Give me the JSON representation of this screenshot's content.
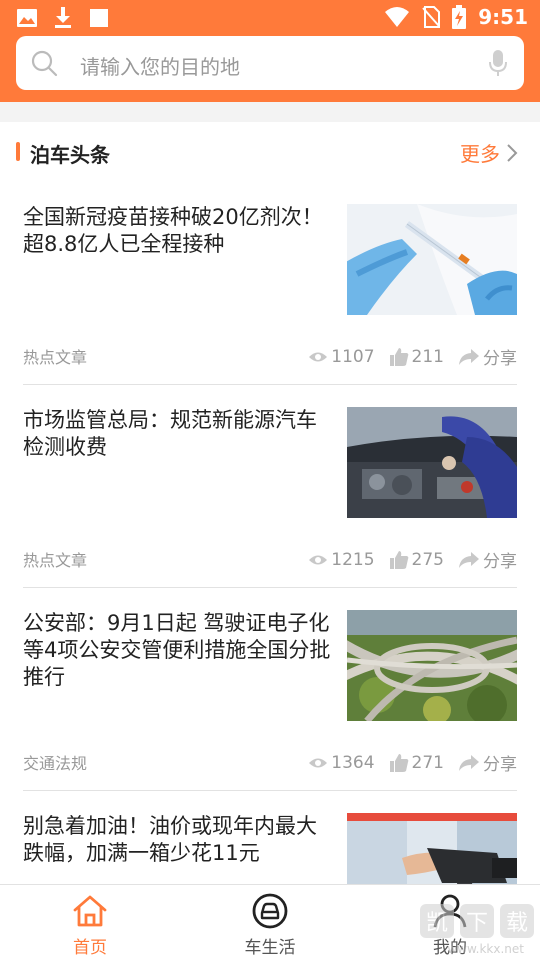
{
  "status_bar": {
    "time": "9:51",
    "left_icons": [
      "image-icon",
      "download-icon",
      "square-icon"
    ],
    "right_icons": [
      "wifi-icon",
      "no-sim-icon",
      "battery-charging-icon"
    ]
  },
  "search": {
    "placeholder": "请输入您的目的地",
    "icon": "search-icon",
    "voice_icon": "microphone-icon"
  },
  "section": {
    "title": "泊车头条",
    "more_label": "更多"
  },
  "articles": [
    {
      "title": "全国新冠疫苗接种破20亿剂次！超8.8亿人已全程接种",
      "category": "热点文章",
      "views": "1107",
      "likes": "211",
      "share": "分享",
      "image": "vaccine-syringe-gloved-hands"
    },
    {
      "title": "市场监管总局：规范新能源汽车检测收费",
      "category": "热点文章",
      "views": "1215",
      "likes": "275",
      "share": "分享",
      "image": "car-engine-inspection"
    },
    {
      "title": "公安部：9月1日起 驾驶证电子化等4项公安交管便利措施全国分批推行",
      "category": "交通法规",
      "views": "1364",
      "likes": "271",
      "share": "分享",
      "image": "highway-interchange-aerial"
    },
    {
      "title": "别急着加油！油价或现年内最大跌幅，加满一箱少花11元",
      "category": "",
      "views": "",
      "likes": "",
      "share": "",
      "image": "fuel-pump-nozzle"
    }
  ],
  "tabbar": {
    "tabs": [
      {
        "label": "首页",
        "icon": "home-icon",
        "active": true
      },
      {
        "label": "车生活",
        "icon": "car-circle-icon",
        "active": false
      },
      {
        "label": "我的",
        "icon": "user-icon",
        "active": false
      }
    ]
  },
  "watermark": {
    "text": "www.kkx.net"
  },
  "colors": {
    "accent": "#ff7a3a",
    "muted": "#999999",
    "divider": "#e2e2e2"
  }
}
